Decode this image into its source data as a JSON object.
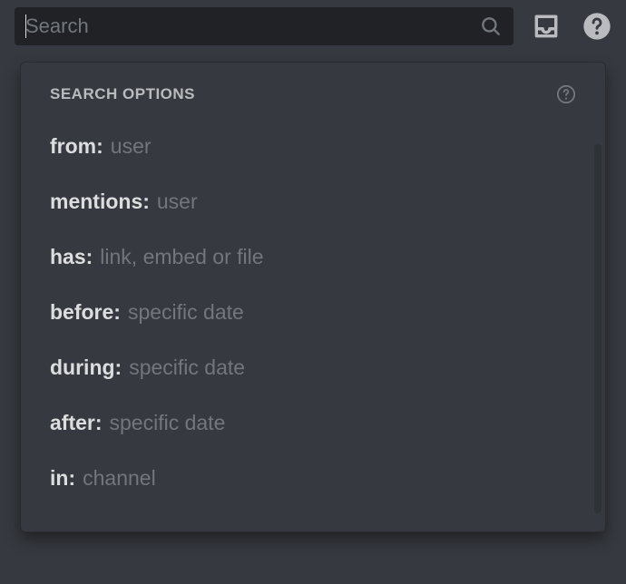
{
  "search": {
    "placeholder": "Search"
  },
  "dropdown": {
    "title": "SEARCH OPTIONS",
    "options": [
      {
        "key": "from:",
        "value": "user"
      },
      {
        "key": "mentions:",
        "value": "user"
      },
      {
        "key": "has:",
        "value": "link, embed or file"
      },
      {
        "key": "before:",
        "value": "specific date"
      },
      {
        "key": "during:",
        "value": "specific date"
      },
      {
        "key": "after:",
        "value": "specific date"
      },
      {
        "key": "in:",
        "value": "channel"
      }
    ]
  }
}
